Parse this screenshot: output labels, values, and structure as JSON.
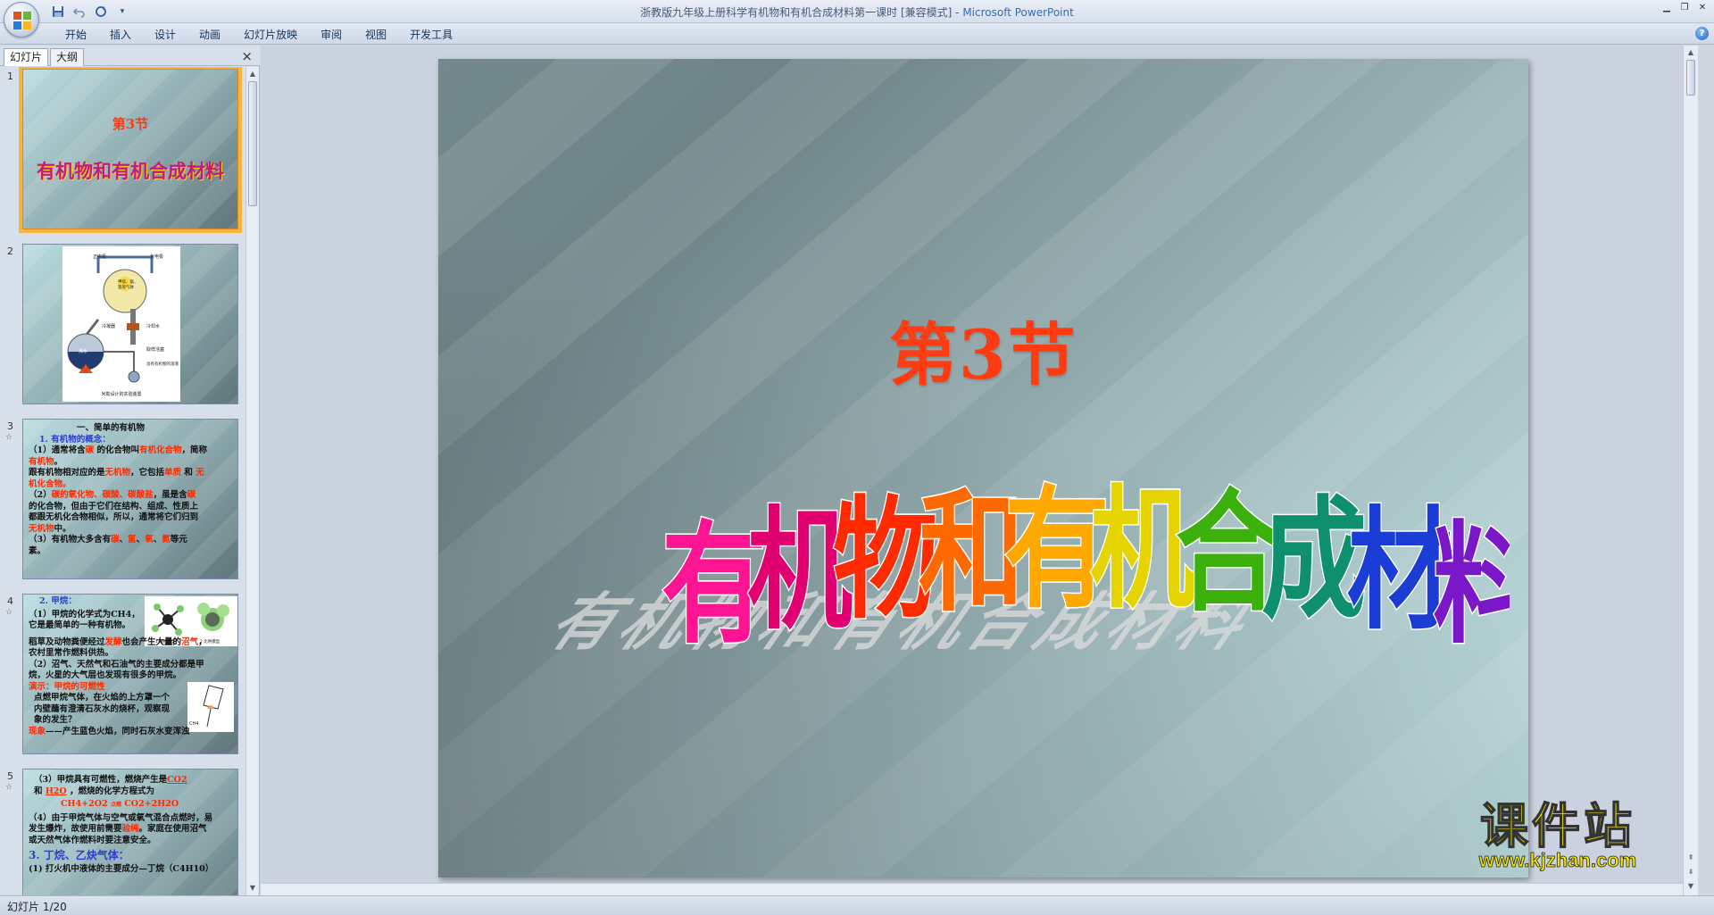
{
  "window": {
    "title_doc": "浙教版九年级上册科学有机物和有机合成材料第一课时 [兼容模式] - ",
    "title_app": "Microsoft PowerPoint"
  },
  "qat": {
    "save": "save-icon",
    "undo": "undo-icon",
    "redo": "redo-icon",
    "more": "▾"
  },
  "ribbon": {
    "tabs": [
      "开始",
      "插入",
      "设计",
      "动画",
      "幻灯片放映",
      "审阅",
      "视图",
      "开发工具"
    ]
  },
  "pane": {
    "tab_slides": "幻灯片",
    "tab_outline": "大纲",
    "close": "×"
  },
  "thumbnails": [
    {
      "num": "1",
      "subtitle": "第3节",
      "title": "有机物和有机合成材料"
    },
    {
      "num": "2",
      "labels": [
        "正电极",
        "负电极",
        "甲烷、氨、氢等气体",
        "冷凝器",
        "冷却水",
        "取样活塞",
        "沸水",
        "含有有机物的溶液",
        "米勒设计的实验装置"
      ]
    },
    {
      "num": "3",
      "heading": "一、简单的有机物",
      "sub": "1. 有机物的概念：",
      "l1a": "（1）通常将含",
      "l1b": "碳",
      "l1c": " 的化合物叫",
      "l1d": "有机化合物",
      "l1e": "，简称",
      "l2a": "有机物",
      "l2b": "。",
      "l3a": "跟有机物相对应的是",
      "l3b": "无机物",
      "l3c": "，它包括",
      "l3d": "单质",
      "l3e": " 和 ",
      "l3f": "无",
      "l4": "机化合物。",
      "l5a": "（2）",
      "l5b": "碳的氧化物、碳酸、碳酸盐",
      "l5c": "，虽是含",
      "l5d": "碳",
      "l6": "的化合物，但由于它们在结构、组成、性质上",
      "l7": "都跟无机化合物相似，所以，通常将它们归到",
      "l8a": "无机物",
      "l8b": "中。",
      "l9a": "（3）有机物大多含有",
      "l9b": "碳",
      "l9c": "、",
      "l9d": "氢",
      "l9e": "、",
      "l9f": "氧",
      "l9g": "、",
      "l9h": "氮",
      "l9i": "等元",
      "l10": "素。"
    },
    {
      "num": "4",
      "sub": "2. 甲烷：",
      "l1": "（1）甲烷的化学式为CH4，",
      "l2": "它是最简单的一种有机物。",
      "l3a": "稻草及动物粪便经过",
      "l3b": "发酵",
      "l3c": "也会产生大量的",
      "l3d": "沼气",
      "l3e": "，",
      "l4": "农村里常作燃料供热。",
      "l5": "（2）沼气、天然气和石油气的主要成分都是甲",
      "l6": "烷，火星的大气层也发现有很多的甲烷。",
      "l7a": "演示：",
      "l7b": "甲烷的可燃性",
      "l8": "点燃甲烷气体，在火焰的上方罩一个",
      "l9": "内壁蘸有澄清石灰水的烧杯，观察现",
      "l10": "象的发生？",
      "l11a": "现象",
      "l11b": "——产生蓝色火焰，同时石灰水变浑浊",
      "img1": "1 球棍模型",
      "img2": "2 比例模型",
      "img3": "CH4"
    },
    {
      "num": "5",
      "l1a": "（3）甲烷具有可燃性，燃烧产生是",
      "l1b": "CO2",
      "l2a": "和 ",
      "l2b": "H2O",
      "l2c": " ，燃烧的化学方程式为",
      "l3a": "CH4+2O2",
      "l3b": "点燃",
      "l3c": "CO2+2H2O",
      "l4": "（4）由于甲烷气体与空气或氧气混合点燃时，易",
      "l5a": "发生爆炸，故使用前需要",
      "l5b": "验纯",
      "l5c": "。家庭在使用沼气",
      "l6": "或天然气体作燃料时要注意安全。",
      "l7": "3. 丁烷、乙炔气体：",
      "l8": "(1) 打火机中液体的主要成分—丁烷（C4H10）"
    }
  ],
  "slide": {
    "subtitle": "第3节",
    "wordart": [
      "有",
      "机",
      "物",
      "和",
      "有",
      "机",
      "合",
      "成",
      "材",
      "料"
    ],
    "wordart_colors": [
      "#ff1493",
      "#e00070",
      "#ff2a00",
      "#ff6a00",
      "#ffa800",
      "#e6d400",
      "#3cb10e",
      "#0e8f6e",
      "#1c3cd6",
      "#7a18c9"
    ]
  },
  "watermark": {
    "line1": "课件站",
    "line2": "www.kjzhan.com"
  },
  "status": {
    "slide_counter": "幻灯片 1/20"
  }
}
